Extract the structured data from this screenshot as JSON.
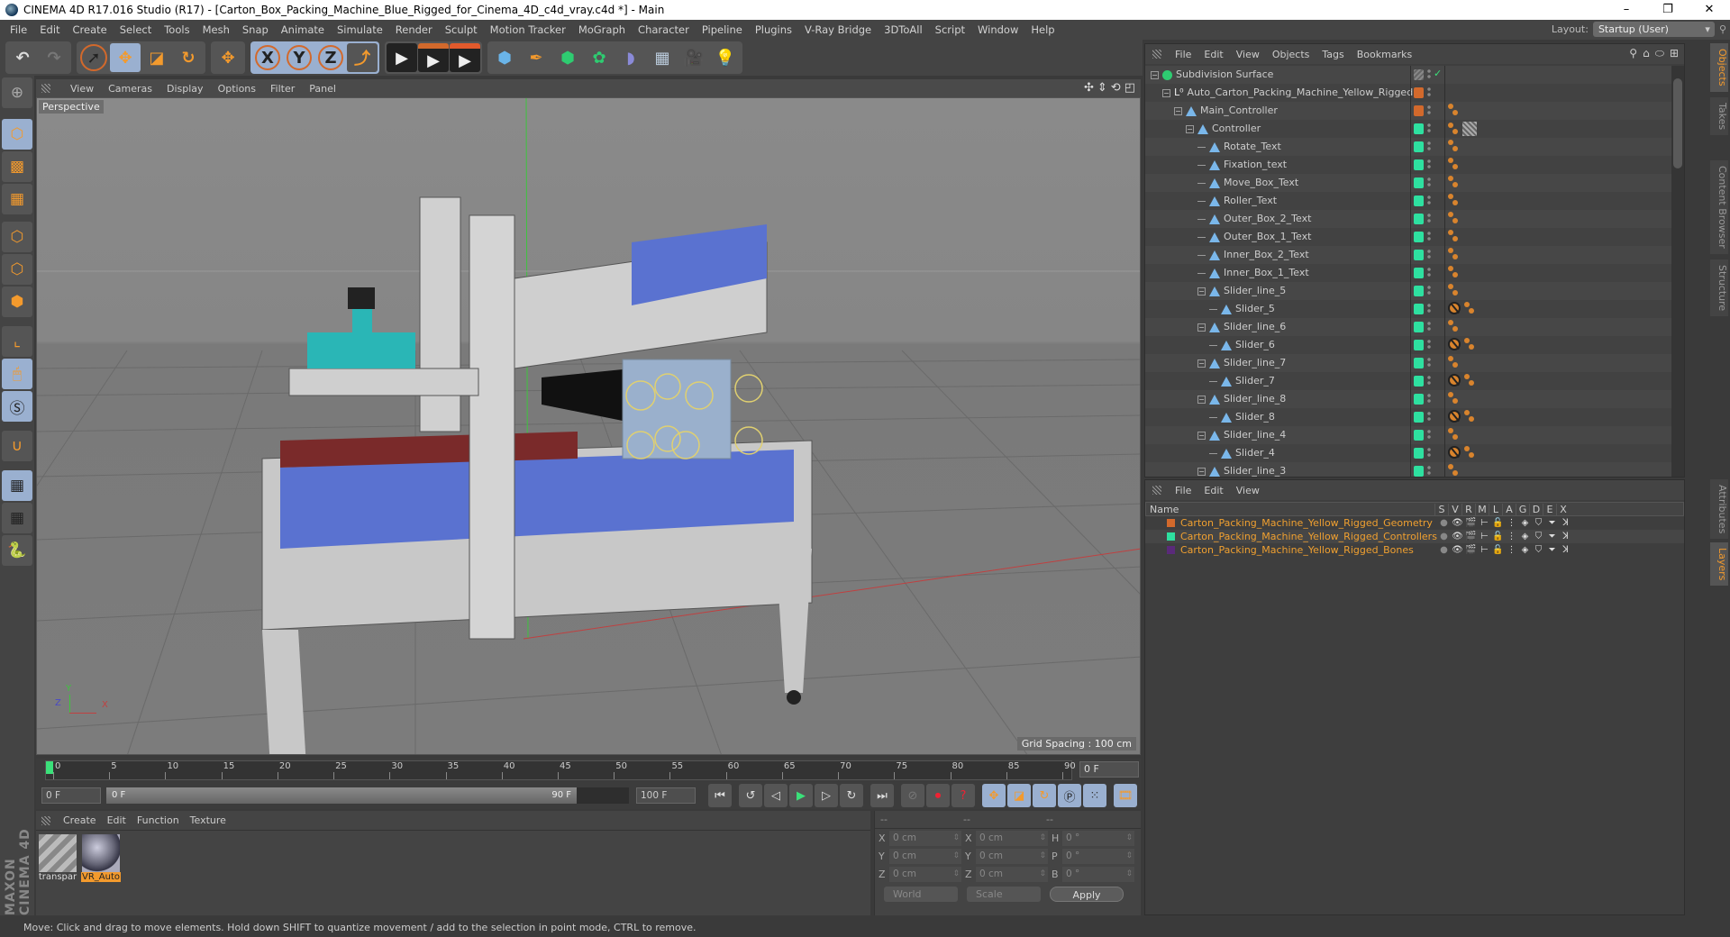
{
  "window": {
    "title": "CINEMA 4D R17.016 Studio (R17) - [Carton_Box_Packing_Machine_Blue_Rigged_for_Cinema_4D_c4d_vray.c4d *] - Main",
    "minimize": "–",
    "maximize": "❐",
    "close": "✕"
  },
  "menubar": [
    "File",
    "Edit",
    "Create",
    "Select",
    "Tools",
    "Mesh",
    "Snap",
    "Animate",
    "Simulate",
    "Render",
    "Sculpt",
    "Motion Tracker",
    "MoGraph",
    "Character",
    "Pipeline",
    "Plugins",
    "V-Ray Bridge",
    "3DToAll",
    "Script",
    "Window",
    "Help"
  ],
  "layout": {
    "label": "Layout:",
    "value": "Startup (User)"
  },
  "toolbar": {
    "undo": "↶",
    "redo": "↷",
    "tools": [
      {
        "name": "live-selection",
        "glyph": "➚",
        "active": false
      },
      {
        "name": "move",
        "glyph": "✥",
        "active": true
      },
      {
        "name": "scale",
        "glyph": "◪",
        "active": false
      },
      {
        "name": "rotate",
        "glyph": "↻",
        "active": false
      },
      {
        "name": "recent",
        "glyph": "✥",
        "active": false
      }
    ],
    "axes": [
      "X",
      "Y",
      "Z"
    ],
    "coord_system": "⤴",
    "render": [
      "🎬",
      "🎬",
      "🎬"
    ],
    "create": [
      "cube",
      "pen",
      "subdivision",
      "cloner",
      "deformer",
      "floor",
      "camera",
      "light"
    ]
  },
  "left_tools": [
    "model-mode",
    "texture-mode",
    "workplane-mode",
    "points-mode",
    "edges-mode",
    "polygons-mode",
    "axis-mode",
    "tweak-mode",
    "solo-mode",
    "snap",
    "grid-lock",
    "grid-sync",
    "python"
  ],
  "viewport": {
    "menu": [
      "View",
      "Cameras",
      "Display",
      "Options",
      "Filter",
      "Panel"
    ],
    "camera_label": "Perspective",
    "grid_spacing": "Grid Spacing : 100 cm",
    "axis_labels": {
      "x": "X",
      "y": "Y",
      "z": "Z"
    }
  },
  "timeline": {
    "ticks": [
      "0",
      "5",
      "10",
      "15",
      "20",
      "25",
      "30",
      "35",
      "40",
      "45",
      "50",
      "55",
      "60",
      "65",
      "70",
      "75",
      "80",
      "85",
      "90"
    ],
    "current_frame": "0 F",
    "start_field": "0 F",
    "range_start": "0 F",
    "range_end": "90 F",
    "end_field": "100 F",
    "range_fill_pct": 90
  },
  "material_manager": {
    "menu": [
      "Create",
      "Edit",
      "Function",
      "Texture"
    ],
    "materials": [
      {
        "name": "transpar",
        "selected": false
      },
      {
        "name": "VR_Auto",
        "selected": true
      }
    ],
    "brand": "MAXON CINEMA 4D"
  },
  "coordinates": {
    "headers": [
      "--",
      "--",
      "--"
    ],
    "rows": [
      {
        "a": "X",
        "v1": "0 cm",
        "b": "X",
        "v2": "0 cm",
        "c": "H",
        "v3": "0 °"
      },
      {
        "a": "Y",
        "v1": "0 cm",
        "b": "Y",
        "v2": "0 cm",
        "c": "P",
        "v3": "0 °"
      },
      {
        "a": "Z",
        "v1": "0 cm",
        "b": "Z",
        "v2": "0 cm",
        "c": "B",
        "v3": "0 °"
      }
    ],
    "space": "World",
    "mode": "Scale",
    "apply": "Apply"
  },
  "status": "Move: Click and drag to move elements. Hold down SHIFT to quantize movement / add to the selection in point mode, CTRL to remove.",
  "object_manager": {
    "menu": [
      "File",
      "Edit",
      "View",
      "Objects",
      "Tags",
      "Bookmarks"
    ],
    "objects": [
      {
        "name": "Subdivision Surface",
        "depth": 0,
        "icon": "subdivision",
        "layer": "#8a8a8a",
        "tags": [],
        "expanded": true
      },
      {
        "name": "Auto_Carton_Packing_Machine_Yellow_Rigged",
        "depth": 1,
        "icon": "null",
        "layer": "#d2692c",
        "tags": [],
        "expanded": true
      },
      {
        "name": "Main_Controller",
        "depth": 2,
        "icon": "joint",
        "layer": "#d2692c",
        "tags": [
          "xpresso"
        ],
        "expanded": true
      },
      {
        "name": "Controller",
        "depth": 3,
        "icon": "joint",
        "layer": "#2ee0a0",
        "tags": [
          "xpresso",
          "texture"
        ],
        "expanded": true
      },
      {
        "name": "Rotate_Text",
        "depth": 4,
        "icon": "joint",
        "layer": "#2ee0a0",
        "tags": [
          "xpresso"
        ]
      },
      {
        "name": "Fixation_text",
        "depth": 4,
        "icon": "joint",
        "layer": "#2ee0a0",
        "tags": [
          "xpresso"
        ]
      },
      {
        "name": "Move_Box_Text",
        "depth": 4,
        "icon": "joint",
        "layer": "#2ee0a0",
        "tags": [
          "xpresso"
        ]
      },
      {
        "name": "Roller_Text",
        "depth": 4,
        "icon": "joint",
        "layer": "#2ee0a0",
        "tags": [
          "xpresso"
        ]
      },
      {
        "name": "Outer_Box_2_Text",
        "depth": 4,
        "icon": "joint",
        "layer": "#2ee0a0",
        "tags": [
          "xpresso"
        ]
      },
      {
        "name": "Outer_Box_1_Text",
        "depth": 4,
        "icon": "joint",
        "layer": "#2ee0a0",
        "tags": [
          "xpresso"
        ]
      },
      {
        "name": "Inner_Box_2_Text",
        "depth": 4,
        "icon": "joint",
        "layer": "#2ee0a0",
        "tags": [
          "xpresso"
        ]
      },
      {
        "name": "Inner_Box_1_Text",
        "depth": 4,
        "icon": "joint",
        "layer": "#2ee0a0",
        "tags": [
          "xpresso"
        ]
      },
      {
        "name": "Slider_line_5",
        "depth": 4,
        "icon": "joint",
        "layer": "#2ee0a0",
        "tags": [
          "xpresso"
        ],
        "expanded": true
      },
      {
        "name": "Slider_5",
        "depth": 5,
        "icon": "joint",
        "layer": "#2ee0a0",
        "tags": [
          "protection",
          "xpresso"
        ]
      },
      {
        "name": "Slider_line_6",
        "depth": 4,
        "icon": "joint",
        "layer": "#2ee0a0",
        "tags": [
          "xpresso"
        ],
        "expanded": true
      },
      {
        "name": "Slider_6",
        "depth": 5,
        "icon": "joint",
        "layer": "#2ee0a0",
        "tags": [
          "protection",
          "xpresso"
        ]
      },
      {
        "name": "Slider_line_7",
        "depth": 4,
        "icon": "joint",
        "layer": "#2ee0a0",
        "tags": [
          "xpresso"
        ],
        "expanded": true
      },
      {
        "name": "Slider_7",
        "depth": 5,
        "icon": "joint",
        "layer": "#2ee0a0",
        "tags": [
          "protection",
          "xpresso"
        ]
      },
      {
        "name": "Slider_line_8",
        "depth": 4,
        "icon": "joint",
        "layer": "#2ee0a0",
        "tags": [
          "xpresso"
        ],
        "expanded": true
      },
      {
        "name": "Slider_8",
        "depth": 5,
        "icon": "joint",
        "layer": "#2ee0a0",
        "tags": [
          "protection",
          "xpresso"
        ]
      },
      {
        "name": "Slider_line_4",
        "depth": 4,
        "icon": "joint",
        "layer": "#2ee0a0",
        "tags": [
          "xpresso"
        ],
        "expanded": true
      },
      {
        "name": "Slider_4",
        "depth": 5,
        "icon": "joint",
        "layer": "#2ee0a0",
        "tags": [
          "protection",
          "xpresso"
        ]
      },
      {
        "name": "Slider_line_3",
        "depth": 4,
        "icon": "joint",
        "layer": "#2ee0a0",
        "tags": [
          "xpresso"
        ],
        "expanded": true
      }
    ]
  },
  "side_tabs_top": [
    "Objects",
    "Takes",
    "Content Browser",
    "Structure"
  ],
  "side_tabs_bottom": [
    "Attributes",
    "Layers"
  ],
  "layer_manager": {
    "menu": [
      "File",
      "Edit",
      "View"
    ],
    "name_header": "Name",
    "columns": [
      "S",
      "V",
      "R",
      "M",
      "L",
      "A",
      "G",
      "D",
      "E",
      "X"
    ],
    "layers": [
      {
        "name": "Carton_Packing_Machine_Yellow_Rigged_Geometry",
        "color": "#d2692c"
      },
      {
        "name": "Carton_Packing_Machine_Yellow_Rigged_Controllers",
        "color": "#2ee0a0"
      },
      {
        "name": "Carton_Packing_Machine_Yellow_Rigged_Bones",
        "color": "#5a2a7a"
      }
    ]
  },
  "colors": {
    "accent": "#f39a2d",
    "active_tool": "#9ab0d0",
    "bg": "#3a3a3a"
  }
}
